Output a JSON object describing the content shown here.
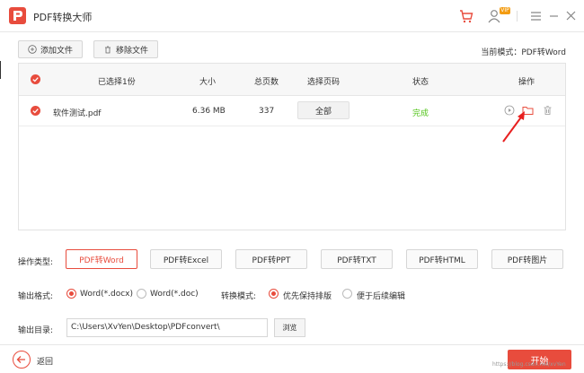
{
  "app": {
    "title": "PDF转换大师",
    "vip_badge": "VIP"
  },
  "toolbar": {
    "add_label": "添加文件",
    "remove_label": "移除文件",
    "mode_prefix": "当前模式：",
    "mode_value": "PDF转Word"
  },
  "table": {
    "headers": {
      "selected": "已选择1份",
      "size": "大小",
      "pages": "总页数",
      "page_select": "选择页码",
      "status": "状态",
      "actions": "操作"
    },
    "rows": [
      {
        "name": "软件测试.pdf",
        "size": "6.36 MB",
        "pages": "337",
        "page_select": "全部",
        "status": "完成"
      }
    ]
  },
  "options": {
    "op_type_label": "操作类型:",
    "formats": [
      "PDF转Word",
      "PDF转Excel",
      "PDF转PPT",
      "PDF转TXT",
      "PDF转HTML",
      "PDF转图片"
    ],
    "output_format_label": "输出格式:",
    "output_formats": [
      "Word(*.docx)",
      "Word(*.doc)"
    ],
    "convert_mode_label": "转换模式:",
    "convert_modes": [
      "优先保持排版",
      "便于后续编辑"
    ],
    "output_dir_label": "输出目录:",
    "output_dir_value": "C:\\Users\\XvYen\\Desktop\\PDFconvert\\",
    "browse_label": "浏览"
  },
  "footer": {
    "back_label": "返回",
    "start_label": "开始",
    "watermark": "https://blog.csdn.net/xvYen"
  },
  "colors": {
    "accent": "#e84c3d",
    "success": "#52c41a"
  }
}
